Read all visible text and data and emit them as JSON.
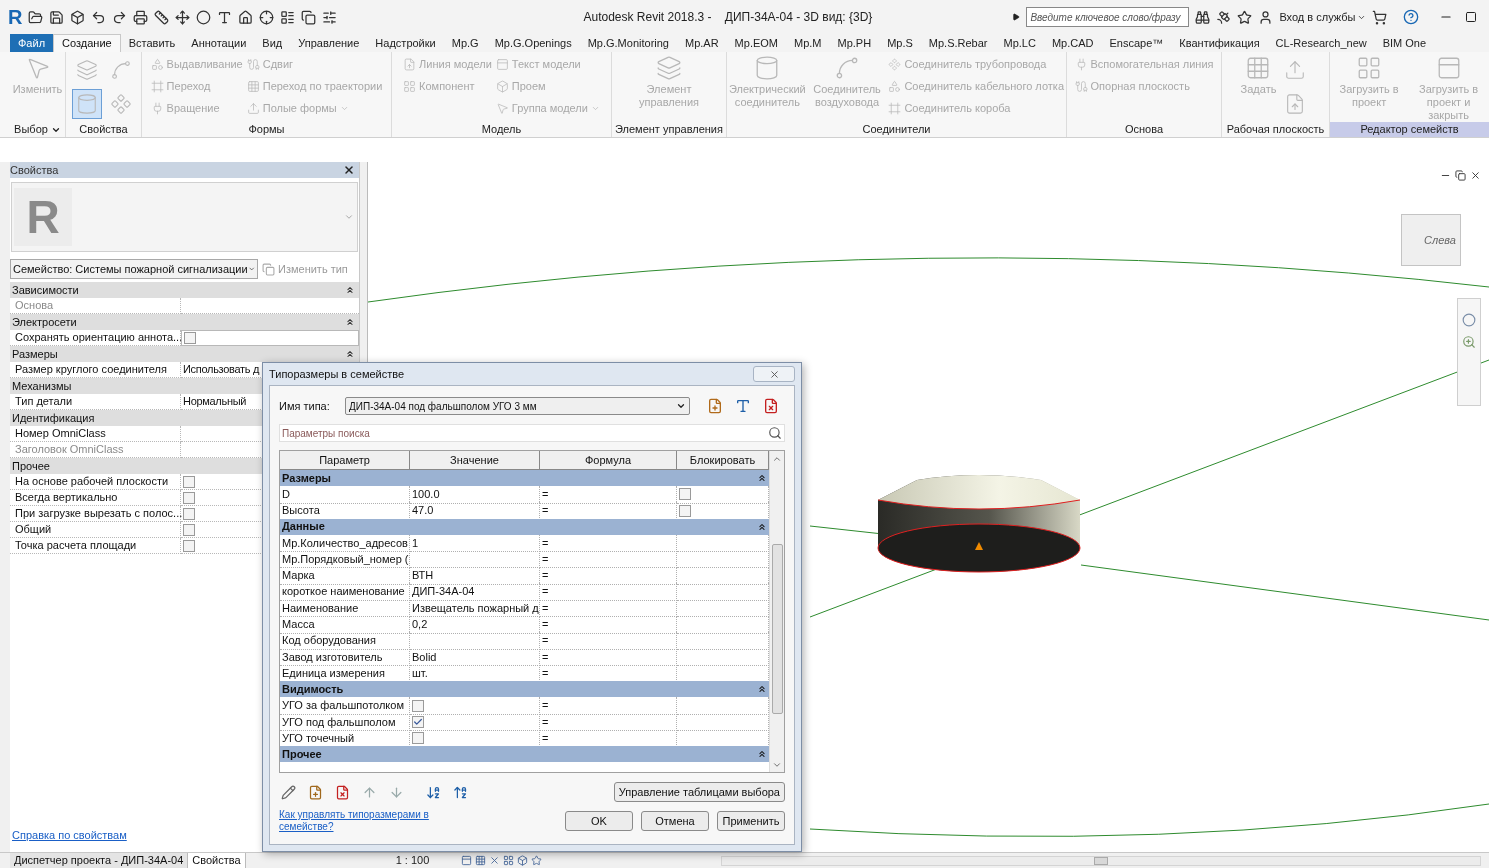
{
  "title_bar": {
    "logo": "R",
    "title": "Autodesk Revit 2018.3 -    ДИП-34А-04 - 3D вид: {3D}",
    "search_placeholder": "Введите ключевое слово/фразу",
    "sign_in": "Вход в службы"
  },
  "ribbon_tabs": [
    {
      "label": "Файл",
      "kind": "file",
      "selected": false
    },
    {
      "label": "Создание",
      "kind": "tab",
      "selected": true
    },
    {
      "label": "Вставить",
      "kind": "tab",
      "selected": false
    },
    {
      "label": "Аннотации",
      "kind": "tab",
      "selected": false
    },
    {
      "label": "Вид",
      "kind": "tab",
      "selected": false
    },
    {
      "label": "Управление",
      "kind": "tab",
      "selected": false
    },
    {
      "label": "Надстройки",
      "kind": "tab",
      "selected": false
    },
    {
      "label": "Mp.G",
      "kind": "tab",
      "selected": false
    },
    {
      "label": "Mp.G.Openings",
      "kind": "tab",
      "selected": false
    },
    {
      "label": "Mp.G.Monitoring",
      "kind": "tab",
      "selected": false
    },
    {
      "label": "Mp.AR",
      "kind": "tab",
      "selected": false
    },
    {
      "label": "Mp.EOM",
      "kind": "tab",
      "selected": false
    },
    {
      "label": "Mp.M",
      "kind": "tab",
      "selected": false
    },
    {
      "label": "Mp.PH",
      "kind": "tab",
      "selected": false
    },
    {
      "label": "Mp.S",
      "kind": "tab",
      "selected": false
    },
    {
      "label": "Mp.S.Rebar",
      "kind": "tab",
      "selected": false
    },
    {
      "label": "Mp.LC",
      "kind": "tab",
      "selected": false
    },
    {
      "label": "Mp.CAD",
      "kind": "tab",
      "selected": false
    },
    {
      "label": "Enscape™",
      "kind": "tab",
      "selected": false
    },
    {
      "label": "Квантификация",
      "kind": "tab",
      "selected": false
    },
    {
      "label": "CL-Research_new",
      "kind": "tab",
      "selected": false
    },
    {
      "label": "BIM One",
      "kind": "tab",
      "selected": false
    }
  ],
  "ribbon": {
    "tools_disabled": true,
    "panels": [
      {
        "label": "Выбор",
        "dropdown": true,
        "highlighted": false,
        "columns": [
          [
            {
              "kind": "large",
              "label": "Изменить"
            }
          ]
        ]
      },
      {
        "label": "Свойства",
        "dropdown": false,
        "highlighted": false,
        "columns": [
          [
            {
              "kind": "icon",
              "selected": false
            },
            {
              "kind": "icon",
              "selected": true
            }
          ],
          [
            {
              "kind": "icon",
              "selected": false
            },
            {
              "kind": "icon",
              "selected": false
            }
          ]
        ]
      },
      {
        "label": "Формы",
        "dropdown": false,
        "highlighted": false,
        "columns": [
          [
            {
              "kind": "small",
              "label": "Выдавливание",
              "dropdown": false
            },
            {
              "kind": "small",
              "label": "Переход",
              "dropdown": false
            },
            {
              "kind": "small",
              "label": "Вращение",
              "dropdown": false
            }
          ],
          [
            {
              "kind": "small",
              "label": "Сдвиг",
              "dropdown": false
            },
            {
              "kind": "small",
              "label": "Переход по траектории",
              "dropdown": false
            },
            {
              "kind": "small",
              "label": "Полые формы",
              "dropdown": true
            }
          ]
        ]
      },
      {
        "label": "Модель",
        "dropdown": false,
        "highlighted": false,
        "columns": [
          [
            {
              "kind": "small",
              "label": "Линия  модели",
              "dropdown": false
            },
            {
              "kind": "small",
              "label": "Компонент",
              "dropdown": false
            }
          ],
          [
            {
              "kind": "small",
              "label": "Текст модели",
              "dropdown": false
            },
            {
              "kind": "small",
              "label": "Проем",
              "dropdown": false
            },
            {
              "kind": "small",
              "label": "Группа модели",
              "dropdown": true
            }
          ]
        ]
      },
      {
        "label": "Элемент управления",
        "dropdown": false,
        "highlighted": false,
        "columns": [
          [
            {
              "kind": "large",
              "label": "Элемент управления"
            }
          ]
        ]
      },
      {
        "label": "Соединители",
        "dropdown": false,
        "highlighted": false,
        "columns": [
          [
            {
              "kind": "large",
              "label": "Электрический соединитель"
            }
          ],
          [
            {
              "kind": "large",
              "label": "Соединитель воздуховода"
            }
          ],
          [
            {
              "kind": "small",
              "label": "Соединитель трубопровода",
              "dropdown": false
            },
            {
              "kind": "small",
              "label": "Соединитель кабельного лотка",
              "dropdown": false
            },
            {
              "kind": "small",
              "label": "Соединитель короба",
              "dropdown": false
            }
          ]
        ]
      },
      {
        "label": "Основа",
        "dropdown": false,
        "highlighted": false,
        "columns": [
          [
            {
              "kind": "small",
              "label": "Вспомогательная линия",
              "dropdown": false
            },
            {
              "kind": "small",
              "label": "Опорная плоскость",
              "dropdown": false
            }
          ]
        ]
      },
      {
        "label": "Рабочая плоскость",
        "dropdown": false,
        "highlighted": false,
        "columns": [
          [
            {
              "kind": "large",
              "label": "Задать"
            }
          ],
          [
            {
              "kind": "icon",
              "selected": false
            },
            {
              "kind": "icon",
              "selected": false
            }
          ]
        ]
      },
      {
        "label": "Редактор семейств",
        "dropdown": false,
        "highlighted": true,
        "columns": [
          [
            {
              "kind": "large",
              "label": "Загрузить в проект"
            }
          ],
          [
            {
              "kind": "large",
              "label": "Загрузить в проект и закрыть"
            }
          ]
        ]
      }
    ]
  },
  "properties": {
    "title": "Свойства",
    "preview_logo": "R",
    "family_selector": "Семейство: Системы пожарной сигнализации",
    "edit_type": "Изменить тип",
    "groups": [
      {
        "name": "Зависимости",
        "collapsible": true,
        "rows": [
          {
            "label": "Основа",
            "kind": "text",
            "disabled": true
          }
        ]
      },
      {
        "name": "Электросети",
        "collapsible": true,
        "rows": [
          {
            "label": "Сохранять ориентацию аннота...",
            "kind": "checkbox",
            "checked": false,
            "disabled": false,
            "focused": true
          }
        ]
      },
      {
        "name": "Размеры",
        "collapsible": true,
        "rows": [
          {
            "label": "Размер круглого соединителя",
            "kind": "text",
            "value": "Использовать д",
            "disabled": false
          }
        ]
      },
      {
        "name": "Механизмы",
        "rows": [
          {
            "label": "Тип детали",
            "kind": "text",
            "value": "Нормальный",
            "disabled": false
          }
        ]
      },
      {
        "name": "Идентификация",
        "rows": [
          {
            "label": "Номер OmniClass",
            "kind": "text",
            "disabled": false
          },
          {
            "label": "Заголовок OmniClass",
            "kind": "text",
            "disabled": true
          }
        ]
      },
      {
        "name": "Прочее",
        "rows": [
          {
            "label": "На основе рабочей плоскости",
            "kind": "checkbox",
            "checked": false,
            "disabled": false,
            "focused": false
          },
          {
            "label": "Всегда вертикально",
            "kind": "checkbox",
            "checked": false,
            "disabled": false,
            "focused": false
          },
          {
            "label": "При загрузке вырезать с полос...",
            "kind": "checkbox",
            "checked": false,
            "disabled": false,
            "focused": false
          },
          {
            "label": "Общий",
            "kind": "checkbox",
            "checked": false,
            "disabled": false,
            "focused": false
          },
          {
            "label": "Точка расчета площади",
            "kind": "checkbox",
            "checked": false,
            "disabled": false,
            "focused": false
          }
        ]
      }
    ],
    "help_link": "Справка по свойствам"
  },
  "bottom_tabs": [
    {
      "label": "Диспетчер проекта - ДИП-34А-04",
      "selected": false
    },
    {
      "label": "Свойства",
      "selected": true
    }
  ],
  "view_bar": {
    "scale": "1 : 100"
  },
  "viewport": {
    "viewcube_label": "Слева"
  },
  "dialog": {
    "title": "Типоразмеры в семействе",
    "type_name_label": "Имя типа:",
    "type_name": "ДИП-34А-04 под фальшполом УГО 3 мм",
    "search_placeholder": "Параметры поиска",
    "columns": [
      "Параметр",
      "Значение",
      "Формула",
      "Блокировать"
    ],
    "groups": [
      {
        "name": "Размеры",
        "rows": [
          {
            "parameter": "D",
            "kind": "text",
            "value": "100.0",
            "formula": "=",
            "lockable": true,
            "locked": false
          },
          {
            "parameter": "Высота",
            "kind": "text",
            "value": "47.0",
            "formula": "=",
            "lockable": true,
            "locked": false
          }
        ]
      },
      {
        "name": "Данные",
        "rows": [
          {
            "parameter": "Мр.Количество_адресов",
            "kind": "text",
            "value": "1",
            "formula": "=",
            "lockable": false
          },
          {
            "parameter": "Мр.Порядковый_номер (",
            "kind": "text",
            "formula": "=",
            "lockable": false
          },
          {
            "parameter": "Марка",
            "kind": "text",
            "value": "ВТН",
            "formula": "=",
            "lockable": false
          },
          {
            "parameter": "короткое наименование",
            "kind": "text",
            "value": "ДИП-34А-04",
            "formula": "=",
            "lockable": false
          },
          {
            "parameter": "Наименование",
            "kind": "text",
            "value": "Извещатель пожарный д",
            "formula": "=",
            "lockable": false
          },
          {
            "parameter": "Масса",
            "kind": "text",
            "value": "0,2",
            "formula": "=",
            "lockable": false
          },
          {
            "parameter": "Код оборудования",
            "kind": "text",
            "formula": "=",
            "lockable": false
          },
          {
            "parameter": "Завод изготовитель",
            "kind": "text",
            "value": "Bolid",
            "formula": "=",
            "lockable": false
          },
          {
            "parameter": "Единица измерения",
            "kind": "text",
            "value": "шт.",
            "formula": "=",
            "lockable": false
          }
        ]
      },
      {
        "name": "Видимость",
        "rows": [
          {
            "parameter": "УГО за фальшпотолком",
            "kind": "checkbox",
            "checked": false,
            "formula": "=",
            "lockable": false
          },
          {
            "parameter": "УГО под фальшполом",
            "kind": "checkbox",
            "checked": true,
            "formula": "=",
            "lockable": false
          },
          {
            "parameter": "УГО точечный",
            "kind": "checkbox",
            "checked": false,
            "formula": "=",
            "lockable": false
          }
        ]
      },
      {
        "name": "Прочее"
      }
    ],
    "manage_lookup": "Управление таблицами выбора",
    "help_link": "Как управлять типоразмерами в семействе?",
    "buttons": [
      "OK",
      "Отмена",
      "Применить"
    ]
  }
}
